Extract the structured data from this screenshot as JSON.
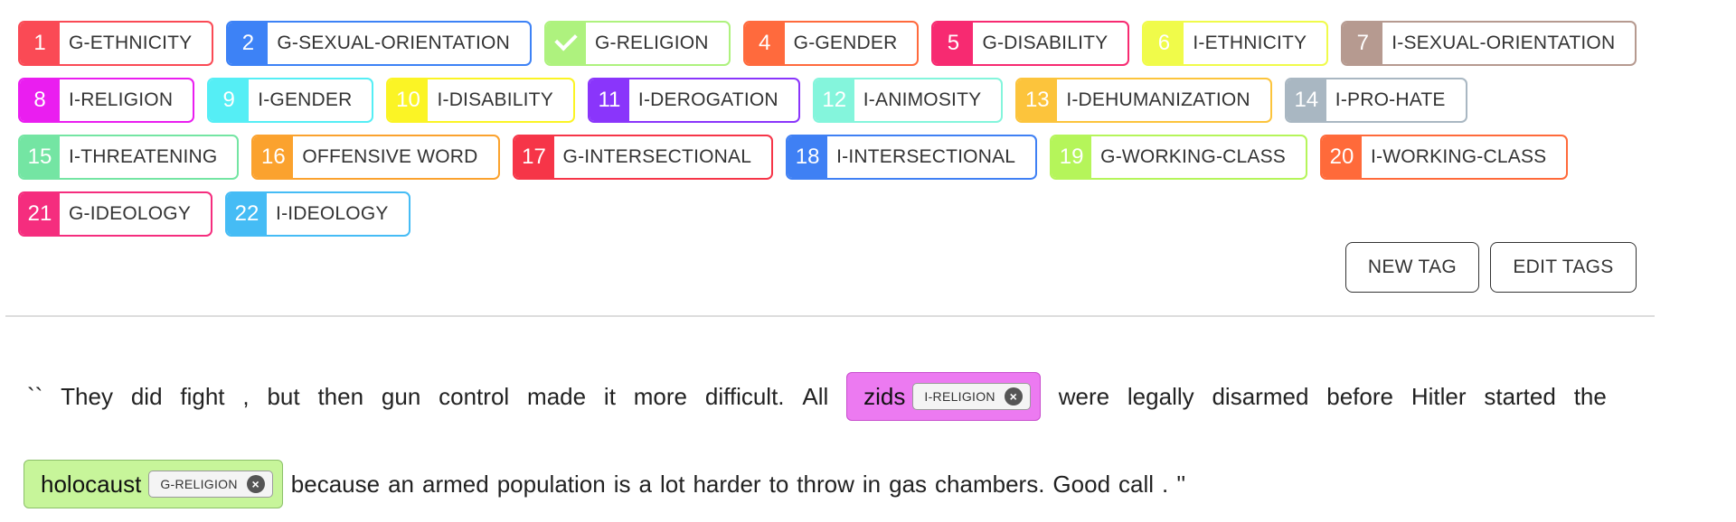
{
  "tags": [
    [
      {
        "num": "1",
        "label": "G-ETHNICITY",
        "color": "#fa4a55"
      },
      {
        "num": "2",
        "label": "G-SEXUAL-ORIENTATION",
        "color": "#3d82f6"
      },
      {
        "num": "",
        "label": "G-RELIGION",
        "color": "#aef27e",
        "checked": true
      },
      {
        "num": "4",
        "label": "G-GENDER",
        "color": "#ff6a3d"
      },
      {
        "num": "5",
        "label": "G-DISABILITY",
        "color": "#f72a71"
      },
      {
        "num": "6",
        "label": "I-ETHNICITY",
        "color": "#f0fb4a"
      },
      {
        "num": "7",
        "label": "I-SEXUAL-ORIENTATION",
        "color": "#b69a90"
      }
    ],
    [
      {
        "num": "8",
        "label": "I-RELIGION",
        "color": "#ea1ef0"
      },
      {
        "num": "9",
        "label": "I-GENDER",
        "color": "#55eef5"
      },
      {
        "num": "10",
        "label": "I-DISABILITY",
        "color": "#fbf425"
      },
      {
        "num": "11",
        "label": "I-DEROGATION",
        "color": "#8a35fb"
      },
      {
        "num": "12",
        "label": "I-ANIMOSITY",
        "color": "#84f5dc"
      },
      {
        "num": "13",
        "label": "I-DEHUMANIZATION",
        "color": "#fcc43c"
      },
      {
        "num": "14",
        "label": "I-PRO-HATE",
        "color": "#a9b7c2"
      }
    ],
    [
      {
        "num": "15",
        "label": "I-THREATENING",
        "color": "#74e5a3"
      },
      {
        "num": "16",
        "label": "OFFENSIVE WORD",
        "color": "#fba22e"
      },
      {
        "num": "17",
        "label": "G-INTERSECTIONAL",
        "color": "#f63548"
      },
      {
        "num": "18",
        "label": "I-INTERSECTIONAL",
        "color": "#3f80f4"
      },
      {
        "num": "19",
        "label": "G-WORKING-CLASS",
        "color": "#b5f55a"
      },
      {
        "num": "20",
        "label": "I-WORKING-CLASS",
        "color": "#ff6a3a"
      }
    ],
    [
      {
        "num": "21",
        "label": "G-IDEOLOGY",
        "color": "#f52d7e"
      },
      {
        "num": "22",
        "label": "I-IDEOLOGY",
        "color": "#45bcf5"
      }
    ]
  ],
  "buttons": {
    "new_tag": "NEW TAG",
    "edit_tags": "EDIT TAGS"
  },
  "document": {
    "line1": {
      "before": [
        "``",
        "They",
        "did",
        "fight",
        ",",
        "but",
        "then",
        "gun",
        "control",
        "made",
        "it",
        "more",
        "difficult.",
        "All"
      ],
      "entity": {
        "text": "zids",
        "tag": "I-RELIGION",
        "bg": "#ec7af1",
        "border": "#c84dcd"
      },
      "after": [
        "were",
        "legally",
        "disarmed",
        "before",
        "Hitler",
        "started",
        "the"
      ]
    },
    "line2": {
      "entity": {
        "text": "holocaust",
        "tag": "G-RELIGION",
        "bg": "#c7f59a",
        "border": "#8cc06a"
      },
      "after": [
        "because",
        "an",
        "armed",
        "population",
        "is",
        "a",
        "lot",
        "harder",
        "to",
        "throw",
        "in",
        "gas",
        "chambers.",
        "Good",
        "call",
        ".",
        "''"
      ]
    }
  }
}
